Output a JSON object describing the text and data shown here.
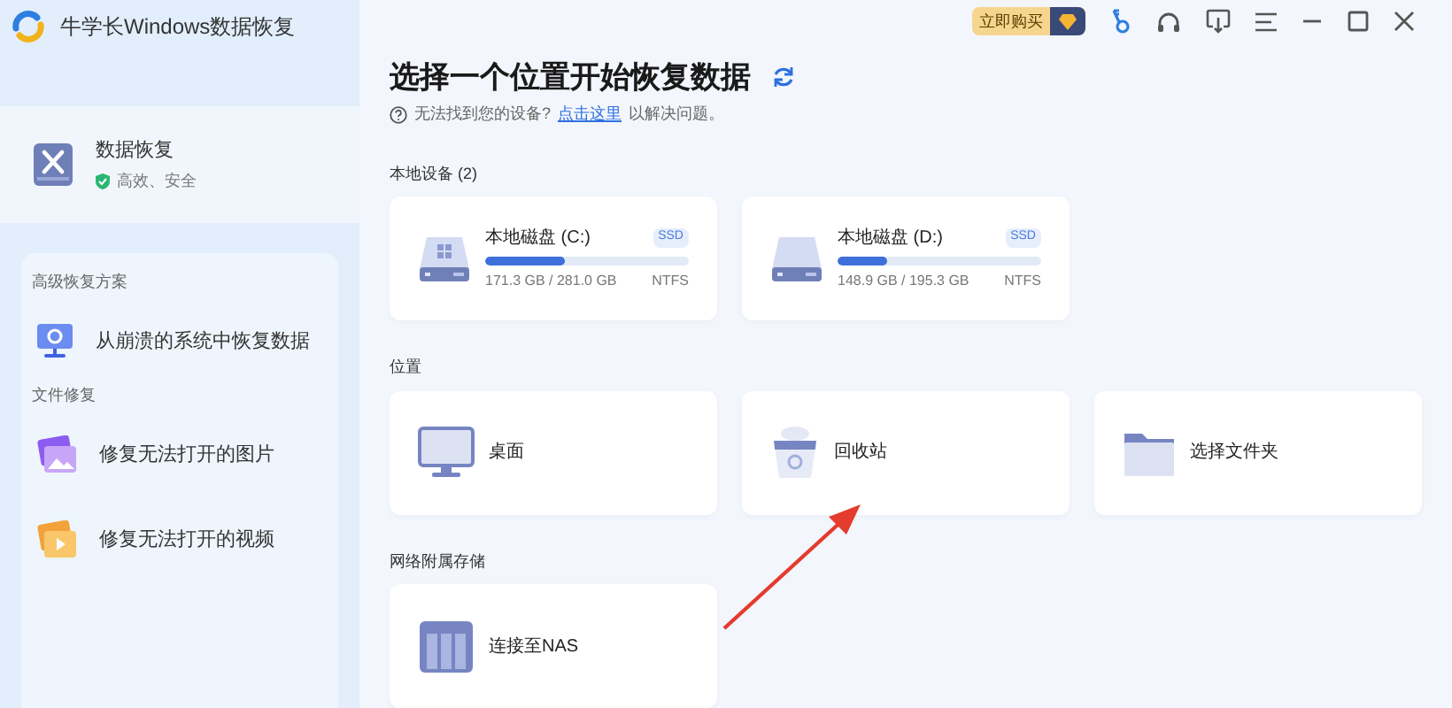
{
  "app": {
    "title": "牛学长Windows数据恢复"
  },
  "toolbar": {
    "buy_label": "立即购买"
  },
  "sidebar": {
    "primary": {
      "label": "数据恢复",
      "note": "高效、安全",
      "selected": true
    },
    "sections": [
      {
        "heading": "高级恢复方案",
        "items": [
          {
            "label": "从崩溃的系统中恢复数据",
            "kind": "system",
            "selected": false
          }
        ]
      },
      {
        "heading": "文件修复",
        "items": [
          {
            "label": "修复无法打开的图片",
            "kind": "photo",
            "selected": false
          },
          {
            "label": "修复无法打开的视频",
            "kind": "video",
            "selected": false
          }
        ]
      }
    ]
  },
  "main": {
    "heading": "选择一个位置开始恢复数据",
    "help": {
      "text": "无法找到您的设备?",
      "link": "点击这里",
      "suffix": "以解决问题。"
    },
    "groups": [
      {
        "title": "本地设备 (2)",
        "cards": [
          {
            "kind": "disk",
            "label": "本地磁盘 (C:)",
            "tag": "SSD",
            "usage": "171.3 GB / 281.0 GB",
            "fs": "NTFS",
            "level": 0.39,
            "windows": true
          },
          {
            "kind": "disk",
            "label": "本地磁盘 (D:)",
            "tag": "SSD",
            "usage": "148.9 GB / 195.3 GB",
            "fs": "NTFS",
            "level": 0.24,
            "windows": false
          }
        ]
      },
      {
        "title": "位置",
        "cards": [
          {
            "kind": "desktop",
            "label": "桌面"
          },
          {
            "kind": "recycle",
            "label": "回收站"
          },
          {
            "kind": "folder",
            "label": "选择文件夹"
          }
        ]
      },
      {
        "title": "网络附属存储",
        "cards": [
          {
            "kind": "nas",
            "label": "连接至NAS"
          }
        ]
      }
    ]
  }
}
